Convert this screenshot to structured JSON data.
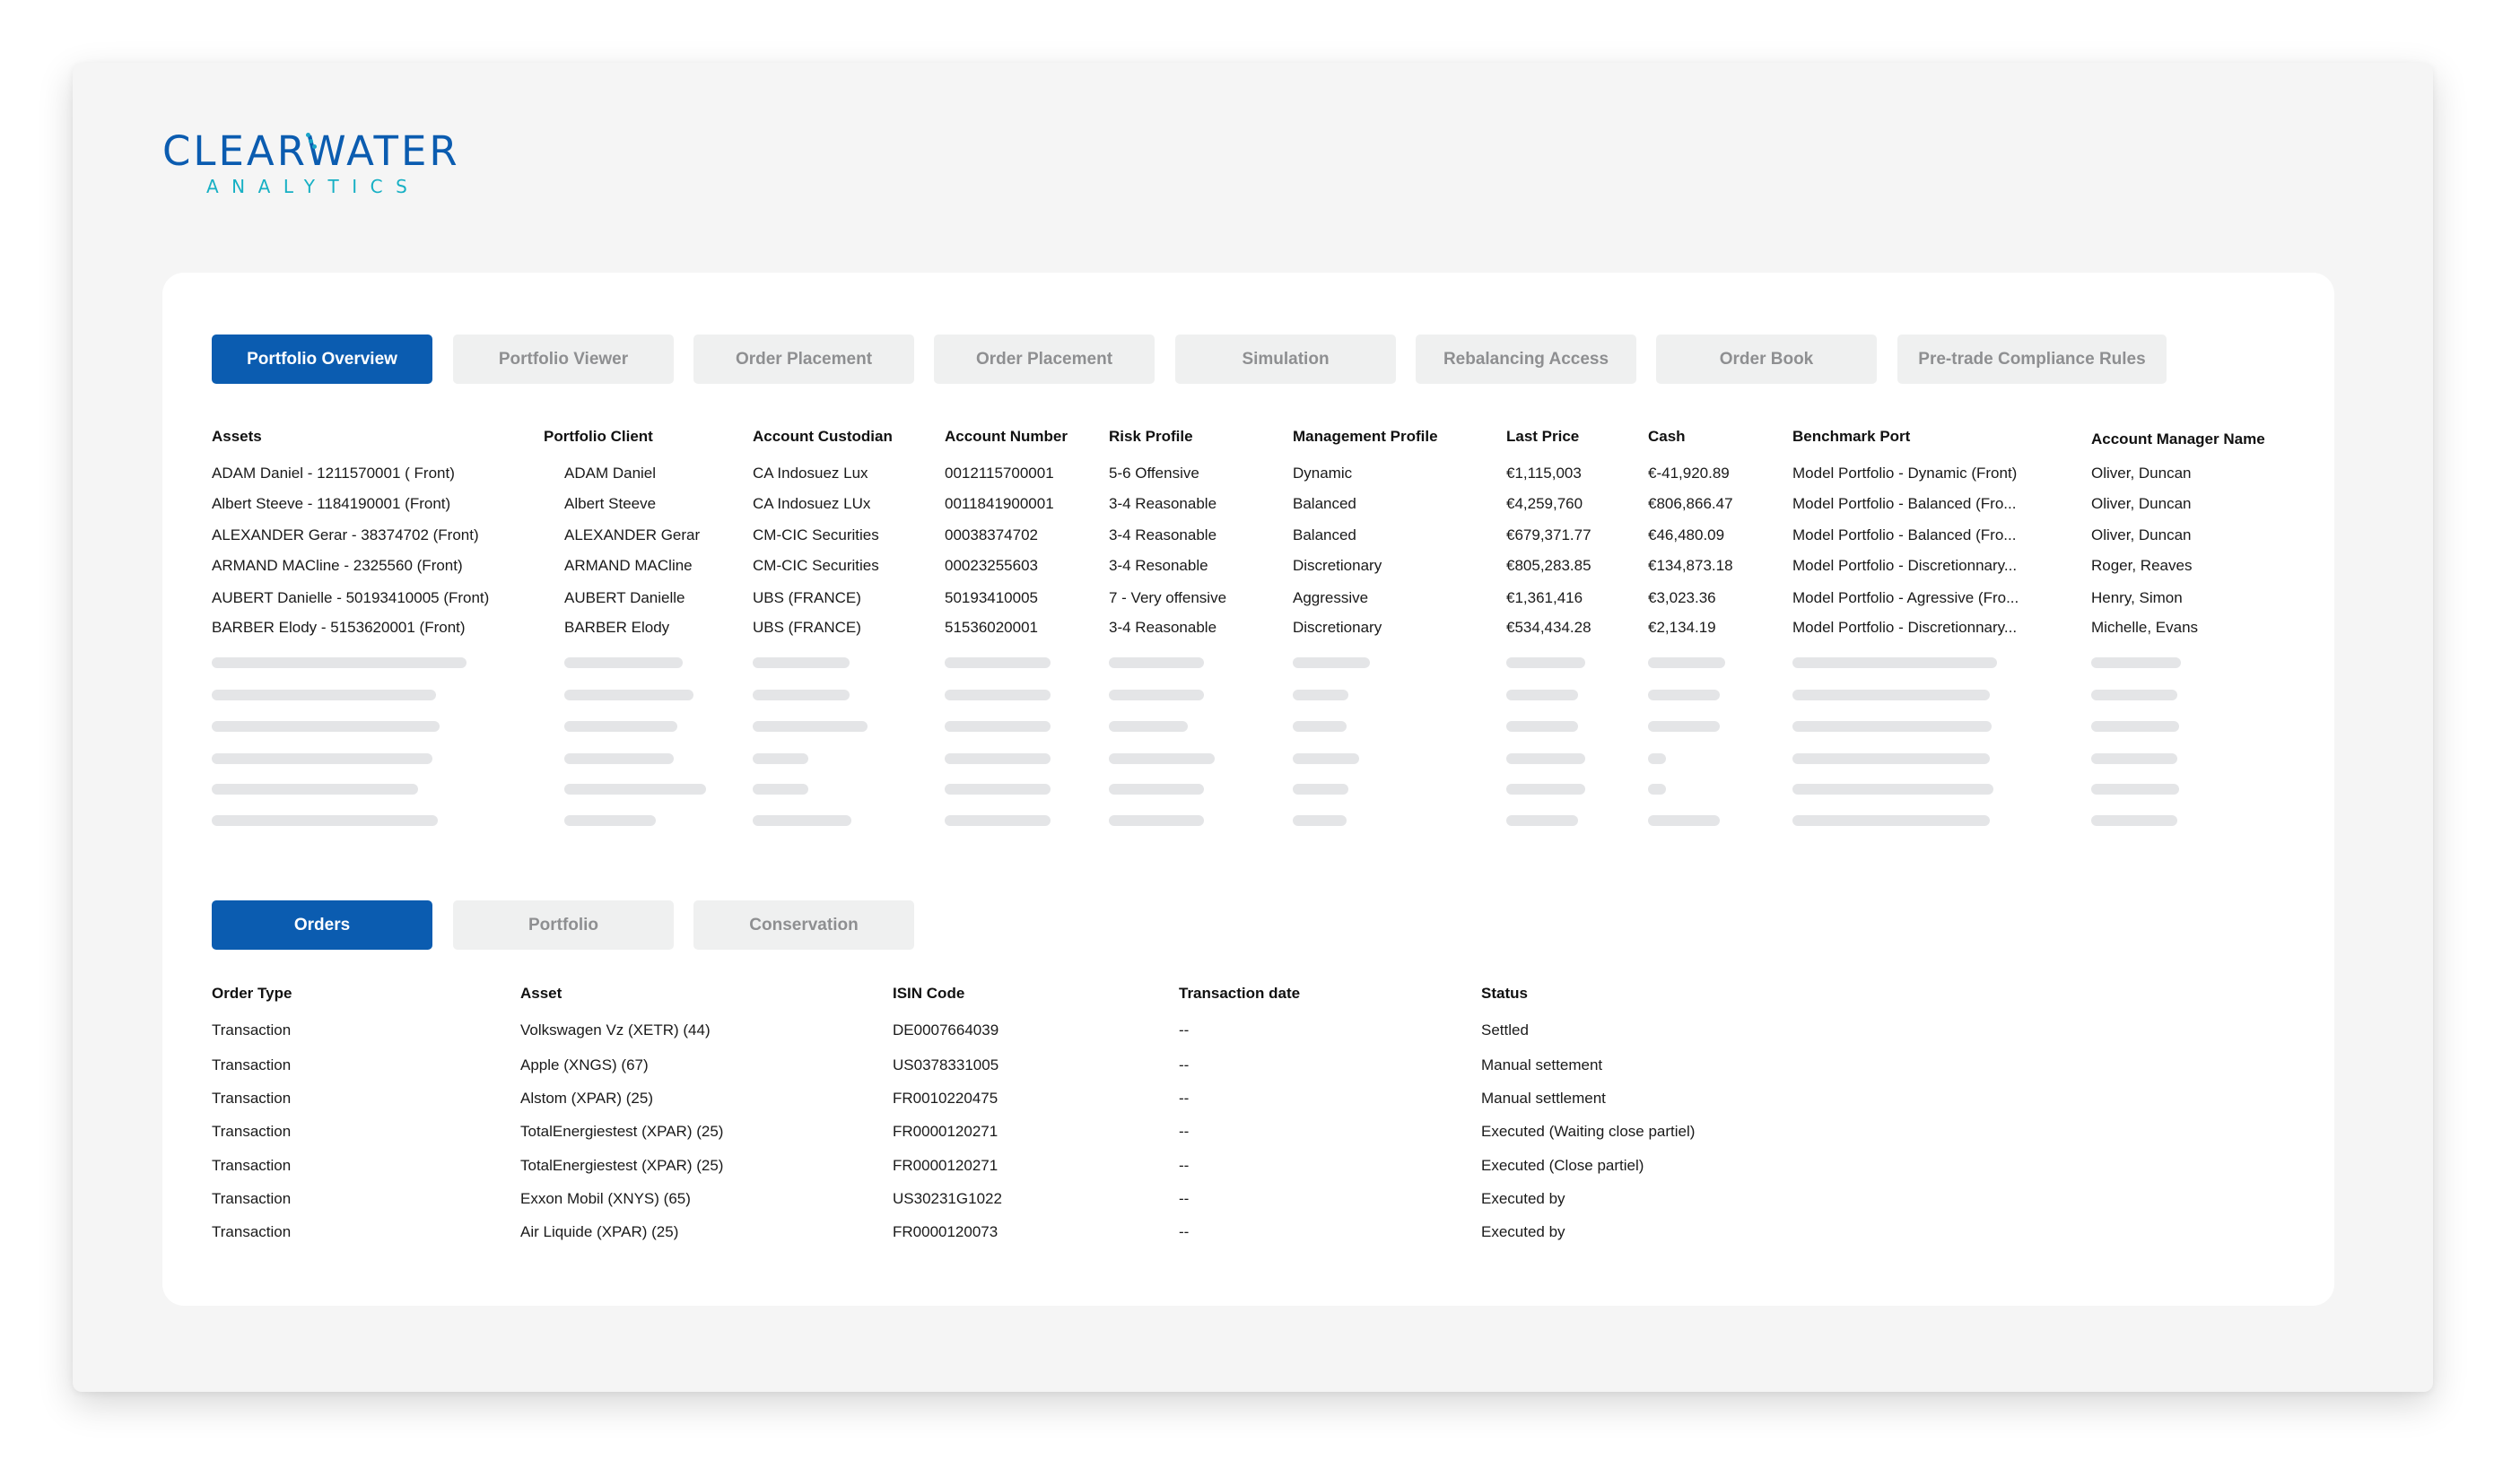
{
  "brand": {
    "name": "CLEARWATER",
    "tagline": "ANALYTICS",
    "colors": {
      "primary": "#0b5cb0",
      "accent": "#17b0c4",
      "tab_inactive_bg": "#eff0f0",
      "tab_inactive_text": "#8e8f91",
      "skeleton": "#e4e5e7"
    }
  },
  "main_tabs": [
    {
      "label": "Portfolio Overview",
      "active": true
    },
    {
      "label": "Portfolio Viewer",
      "active": false
    },
    {
      "label": "Order Placement",
      "active": false
    },
    {
      "label": "Order Placement",
      "active": false
    },
    {
      "label": "Simulation",
      "active": false
    },
    {
      "label": "Rebalancing Access",
      "active": false
    },
    {
      "label": "Order Book",
      "active": false
    },
    {
      "label": "Pre-trade Compliance Rules",
      "active": false
    }
  ],
  "portfolio_table": {
    "columns": [
      "Assets",
      "Portfolio Client",
      "Account Custodian",
      "Account Number",
      "Risk Profile",
      "Management Profile",
      "Last Price",
      "Cash",
      "Benchmark Port",
      "Account Manager Name"
    ],
    "rows": [
      [
        "ADAM Daniel - 1211570001 ( Front)",
        "ADAM Daniel",
        "CA Indosuez Lux",
        "0012115700001",
        "5-6 Offensive",
        "Dynamic",
        "€1,115,003",
        "€-41,920.89",
        "Model Portfolio - Dynamic (Front)",
        "Oliver, Duncan"
      ],
      [
        "Albert Steeve - 1184190001 (Front)",
        "Albert Steeve",
        "CA Indosuez LUx",
        "0011841900001",
        "3-4 Reasonable",
        "Balanced",
        "€4,259,760",
        "€806,866.47",
        "Model Portfolio - Balanced (Fro...",
        "Oliver, Duncan"
      ],
      [
        "ALEXANDER Gerar - 38374702 (Front)",
        "ALEXANDER Gerar",
        "CM-CIC Securities",
        "00038374702",
        "3-4 Reasonable",
        "Balanced",
        "€679,371.77",
        "€46,480.09",
        "Model Portfolio - Balanced (Fro...",
        "Oliver, Duncan"
      ],
      [
        "ARMAND MACline - 2325560 (Front)",
        "ARMAND MACline",
        "CM-CIC Securities",
        "00023255603",
        "3-4 Resonable",
        "Discretionary",
        "€805,283.85",
        "€134,873.18",
        "Model Portfolio - Discretionnary...",
        "Roger, Reaves"
      ],
      [
        "AUBERT Danielle - 50193410005 (Front)",
        "AUBERT Danielle",
        "UBS (FRANCE)",
        "50193410005",
        "7 - Very offensive",
        "Aggressive",
        "€1,361,416",
        "€3,023.36",
        "Model Portfolio - Agressive (Fro...",
        "Henry, Simon"
      ],
      [
        "BARBER Elody - 5153620001 (Front)",
        "BARBER Elody",
        "UBS (FRANCE)",
        "51536020001",
        "3-4 Reasonable",
        "Discretionary",
        "€534,434.28",
        "€2,134.19",
        "Model Portfolio - Discretionnary...",
        "Michelle, Evans"
      ]
    ],
    "loading_placeholder_rows": 6
  },
  "sub_tabs": [
    {
      "label": "Orders",
      "active": true
    },
    {
      "label": "Portfolio",
      "active": false
    },
    {
      "label": "Conservation",
      "active": false
    }
  ],
  "orders_table": {
    "columns": [
      "Order Type",
      "Asset",
      "ISIN Code",
      "Transaction date",
      "Status"
    ],
    "rows": [
      [
        "Transaction",
        "Volkswagen Vz (XETR) (44)",
        "DE0007664039",
        "--",
        "Settled"
      ],
      [
        "Transaction",
        "Apple (XNGS) (67)",
        "US0378331005",
        "--",
        "Manual settement"
      ],
      [
        "Transaction",
        "Alstom (XPAR) (25)",
        "FR0010220475",
        "--",
        "Manual settlement"
      ],
      [
        "Transaction",
        "TotalEnergiestest (XPAR) (25)",
        "FR0000120271",
        "--",
        "Executed (Waiting close partiel)"
      ],
      [
        "Transaction",
        "TotalEnergiestest (XPAR) (25)",
        "FR0000120271",
        "--",
        "Executed (Close partiel)"
      ],
      [
        "Transaction",
        "Exxon Mobil (XNYS) (65)",
        "US30231G1022",
        "--",
        "Executed by"
      ],
      [
        "Transaction",
        "Air Liquide (XPAR) (25)",
        "FR0000120073",
        "--",
        "Executed by"
      ]
    ]
  }
}
